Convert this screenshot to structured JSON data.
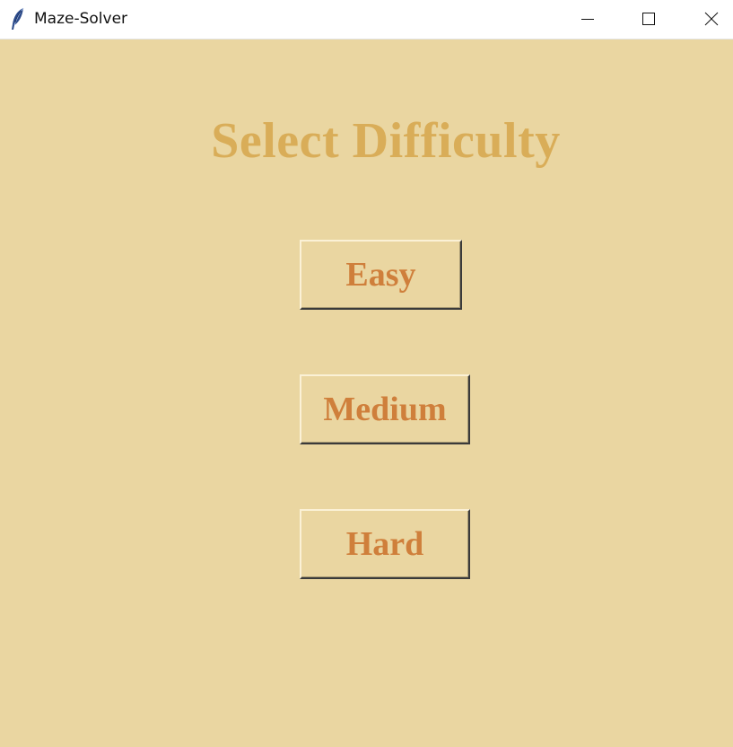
{
  "window": {
    "title": "Maze-Solver",
    "icon": "feather-icon"
  },
  "main": {
    "heading": "Select Difficulty",
    "buttons": [
      {
        "label": "Easy"
      },
      {
        "label": "Medium"
      },
      {
        "label": "Hard"
      }
    ]
  },
  "colors": {
    "background": "#ead6a1",
    "heading": "#d9ad58",
    "button_text": "#cf7f3b"
  }
}
